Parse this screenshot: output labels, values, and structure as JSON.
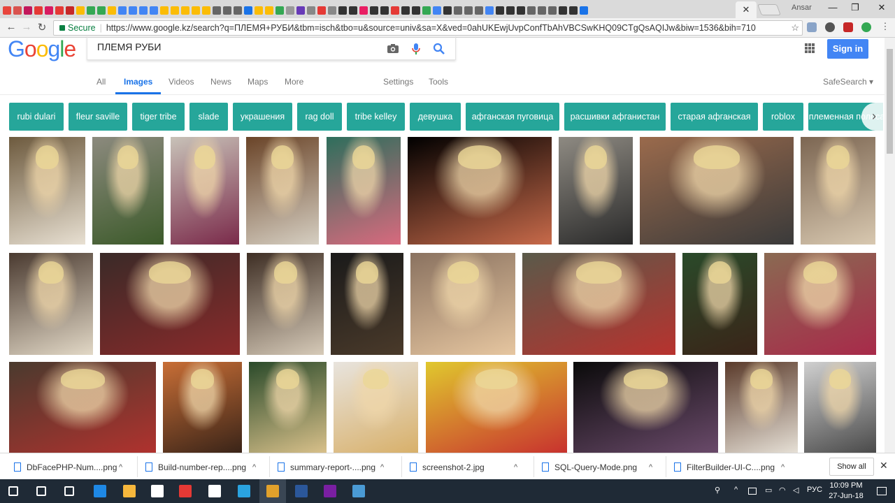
{
  "browser": {
    "active_tab_close": "✕",
    "user_label": "Ansar",
    "window_controls": [
      "—",
      "❐",
      "✕"
    ],
    "back": "←",
    "forward": "→",
    "reload": "↻",
    "secure_label": "Secure",
    "url": "https://www.google.kz/search?q=ПЛЕМЯ+РУБИ&tbm=isch&tbo=u&source=univ&sa=X&ved=0ahUKEwjUvpConfTbAhVBCSwKHQ09CTgQsAQIJw&biw=1536&bih=710",
    "bookmark_star": "☆",
    "tab_favicon_colors": [
      "#e8453c",
      "#d9534f",
      "#c2185b",
      "#e53935",
      "#d81b60",
      "#e53935",
      "#c62828",
      "#fbbc05",
      "#34a853",
      "#34a853",
      "#fbbc05",
      "#4285f4",
      "#4285f4",
      "#4285f4",
      "#4285f4",
      "#fbbc05",
      "#fbbc05",
      "#fbbc05",
      "#fbbc05",
      "#fbbc05",
      "#666",
      "#666",
      "#666",
      "#1a73e8",
      "#fbbc05",
      "#fbbc05",
      "#34a853",
      "#999",
      "#673ab7",
      "#888",
      "#e53935",
      "#888",
      "#333",
      "#333",
      "#e91e63",
      "#333",
      "#333",
      "#e53935",
      "#333",
      "#333",
      "#34a853",
      "#4285f4",
      "#333",
      "#666",
      "#666",
      "#666",
      "#4285f4",
      "#333",
      "#333",
      "#333",
      "#666",
      "#666",
      "#666",
      "#333",
      "#333",
      "#1a73e8"
    ]
  },
  "search": {
    "query": "ПЛЕМЯ РУБИ",
    "sign_in": "Sign in",
    "tabs": [
      "All",
      "Images",
      "Videos",
      "News",
      "Maps",
      "More",
      "Settings",
      "Tools"
    ],
    "active_tab": "Images",
    "safesearch": "SafeSearch ▾"
  },
  "chips": [
    "rubi dulari",
    "fleur saville",
    "tiger tribe",
    "slade",
    "украшения",
    "rag doll",
    "tribe kelley",
    "девушка",
    "афганская пуговица",
    "расшивки афганистан",
    "старая афганская",
    "roblox",
    "племенная полоса"
  ],
  "chip_color": "#26a69a",
  "images": {
    "row1": [
      {
        "w": 109,
        "c1": "#6d5a3e",
        "c2": "#e8e0d2"
      },
      {
        "w": 102,
        "c1": "#8c8a7e",
        "c2": "#3c5a2a"
      },
      {
        "w": 98,
        "c1": "#c8c2b8",
        "c2": "#7a2a4a"
      },
      {
        "w": 104,
        "c1": "#6a4428",
        "c2": "#d6cfc2"
      },
      {
        "w": 106,
        "c1": "#2e6e5c",
        "c2": "#d86a7e"
      },
      {
        "w": 206,
        "c1": "#000000",
        "c2": "#c86a4a"
      },
      {
        "w": 106,
        "c1": "#8e8a82",
        "c2": "#2a2a2a"
      },
      {
        "w": 220,
        "c1": "#9a6a4c",
        "c2": "#3a3a3a"
      },
      {
        "w": 107,
        "c1": "#7c6652",
        "c2": "#d8c8b0"
      }
    ],
    "row2": [
      {
        "w": 120,
        "c1": "#4a3a30",
        "c2": "#e2d8c6"
      },
      {
        "w": 200,
        "c1": "#3a2a28",
        "c2": "#8a2a2a"
      },
      {
        "w": 110,
        "c1": "#3e2e24",
        "c2": "#d6cab8"
      },
      {
        "w": 104,
        "c1": "#1a1a1a",
        "c2": "#4a3a2a"
      },
      {
        "w": 150,
        "c1": "#8a7260",
        "c2": "#e6c6a0"
      },
      {
        "w": 219,
        "c1": "#5a5a4a",
        "c2": "#b8322e"
      },
      {
        "w": 107,
        "c1": "#2a4a2a",
        "c2": "#3a2418"
      },
      {
        "w": 160,
        "c1": "#8a6a52",
        "c2": "#a82a4a"
      }
    ],
    "row3": [
      {
        "w": 210,
        "c1": "#4a3a2e",
        "c2": "#b0322e"
      },
      {
        "w": 113,
        "c1": "#c86e36",
        "c2": "#3a2418"
      },
      {
        "w": 111,
        "c1": "#2a4a2a",
        "c2": "#d8c08a"
      },
      {
        "w": 121,
        "c1": "#e8e4de",
        "c2": "#d8b06a"
      },
      {
        "w": 202,
        "c1": "#e0c82e",
        "c2": "#c8322e"
      },
      {
        "w": 207,
        "c1": "#0a0a0a",
        "c2": "#6a4a6a"
      },
      {
        "w": 104,
        "c1": "#5a3a2a",
        "c2": "#e6e0d6"
      },
      {
        "w": 103,
        "c1": "#d0d0d0",
        "c2": "#4a4a4a"
      }
    ]
  },
  "downloads": [
    {
      "name": "DbFacePHP-Num....png"
    },
    {
      "name": "Build-number-rep....png"
    },
    {
      "name": "summary-report-....png"
    },
    {
      "name": "screenshot-2.jpg"
    },
    {
      "name": "SQL-Query-Mode.png"
    },
    {
      "name": "FilterBuilder-UI-C....png"
    }
  ],
  "downloads_show_all": "Show all",
  "downloads_close": "✕",
  "taskbar": {
    "language": "РУС",
    "time": "10:09 PM",
    "date": "27-Jun-18",
    "app_colors": [
      "#ffffff",
      "#ffffff",
      "#ffffff",
      "#1e88e5",
      "#f6b73c",
      "#ffffff",
      "#e53935",
      "#ffffff",
      "#2aa3e0",
      "#e2a12b",
      "#2b579a",
      "#7a1fa2",
      "#4a9ad4"
    ]
  }
}
